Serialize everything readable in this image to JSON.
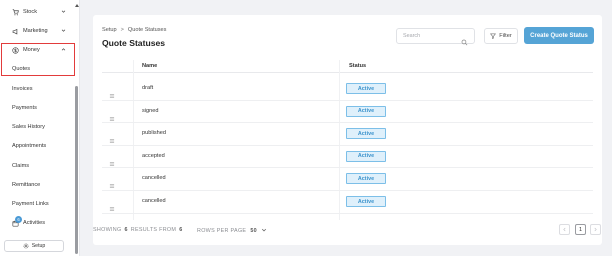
{
  "sidebar": {
    "items": [
      {
        "label": "Stock",
        "icon": "cart-icon",
        "expanded": false
      },
      {
        "label": "Marketing",
        "icon": "megaphone-icon",
        "expanded": false
      },
      {
        "label": "Money",
        "icon": "dollar-icon",
        "expanded": true
      }
    ],
    "money_subitems": [
      "Quotes",
      "Invoices",
      "Payments",
      "Sales History",
      "Appointments",
      "Claims",
      "Remittance",
      "Payment Links"
    ],
    "activities_label": "Activities",
    "activities_badge": "6",
    "setup_label": "Setup"
  },
  "header": {
    "breadcrumb": [
      "Setup",
      "Quote Statuses"
    ],
    "title": "Quote Statuses",
    "search_placeholder": "Search",
    "filter_label": "Filter",
    "create_label": "Create Quote Status"
  },
  "table": {
    "columns": [
      "Name",
      "Status"
    ],
    "rows": [
      {
        "name": "draft",
        "status": "Active"
      },
      {
        "name": "signed",
        "status": "Active"
      },
      {
        "name": "published",
        "status": "Active"
      },
      {
        "name": "accepted",
        "status": "Active"
      },
      {
        "name": "cancelled",
        "status": "Active"
      },
      {
        "name": "cancelled",
        "status": "Active"
      }
    ]
  },
  "footer": {
    "showing_label": "SHOWING",
    "showing_count": "6",
    "results_from_label": "RESULTS FROM",
    "total": "6",
    "rows_per_page_label": "ROWS PER PAGE",
    "rows_per_page": "50",
    "current_page": "1"
  },
  "colors": {
    "accent": "#55a4d6",
    "status_bg": "#dff0fb",
    "status_text": "#3c93cc",
    "highlight": "#e23b3b"
  }
}
